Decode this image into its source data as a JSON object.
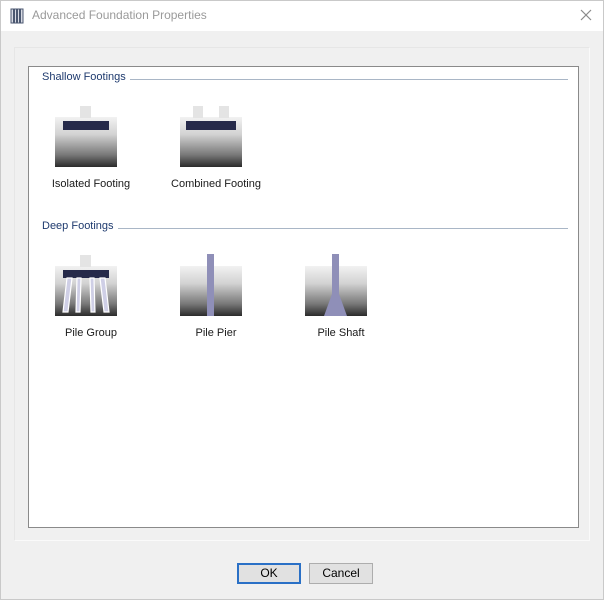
{
  "window": {
    "title": "Advanced Foundation Properties"
  },
  "groups": {
    "shallow": {
      "label": "Shallow Footings",
      "items": [
        {
          "label": "Isolated Footing",
          "icon": "isolated-footing-icon"
        },
        {
          "label": "Combined Footing",
          "icon": "combined-footing-icon"
        }
      ]
    },
    "deep": {
      "label": "Deep Footings",
      "items": [
        {
          "label": "Pile Group",
          "icon": "pile-group-icon"
        },
        {
          "label": "Pile Pier",
          "icon": "pile-pier-icon"
        },
        {
          "label": "Pile Shaft",
          "icon": "pile-shaft-icon"
        }
      ]
    }
  },
  "buttons": {
    "ok": "OK",
    "cancel": "Cancel"
  },
  "colors": {
    "group_label": "#1e3a6e",
    "footing_block": "#262a4a",
    "pile": "#8f8fb8",
    "accent_border": "#2a70c6"
  }
}
